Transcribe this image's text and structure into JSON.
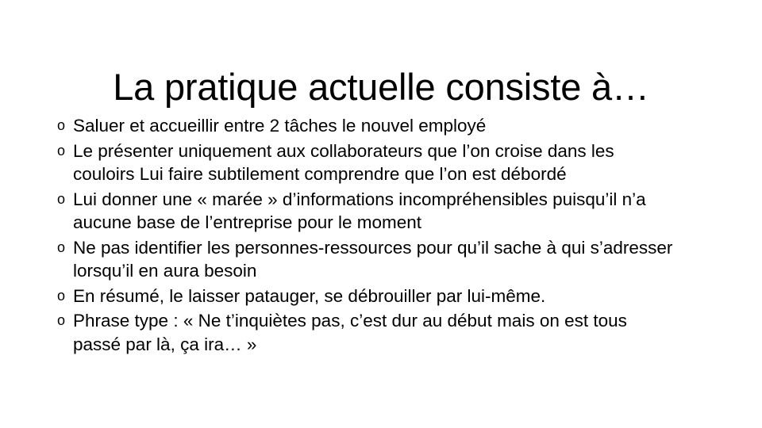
{
  "slide": {
    "title": "La pratique actuelle consiste à…",
    "background_color": "#ffffff",
    "text_color": "#000000",
    "bullet_glyph": "o",
    "bullets": [
      {
        "marker": "o",
        "line1": "Saluer et accueillir entre 2 tâches le nouvel employé",
        "line2": ""
      },
      {
        "marker": "o",
        "line1": "Le présenter uniquement aux collaborateurs que l’on croise dans les",
        "line2": "couloirs Lui faire subtilement comprendre que l’on est débordé"
      },
      {
        "marker": "o",
        "line1": "Lui donner une « marée » d’informations incompréhensibles puisqu’il n’a",
        "line2": "aucune base de l’entreprise pour le moment"
      },
      {
        "marker": "o",
        "line1": "Ne pas identifier les personnes-ressources pour qu’il sache à qui s’adresser",
        "line2": "lorsqu’il en aura besoin"
      },
      {
        "marker": "o",
        "line1": "En résumé, le laisser patauger, se débrouiller par lui-même.",
        "line2": ""
      },
      {
        "marker": "o",
        "line1": "Phrase type : «  Ne t’inquiètes pas, c’est dur au début mais on est tous",
        "line2": "passé par là, ça ira… »"
      }
    ]
  }
}
